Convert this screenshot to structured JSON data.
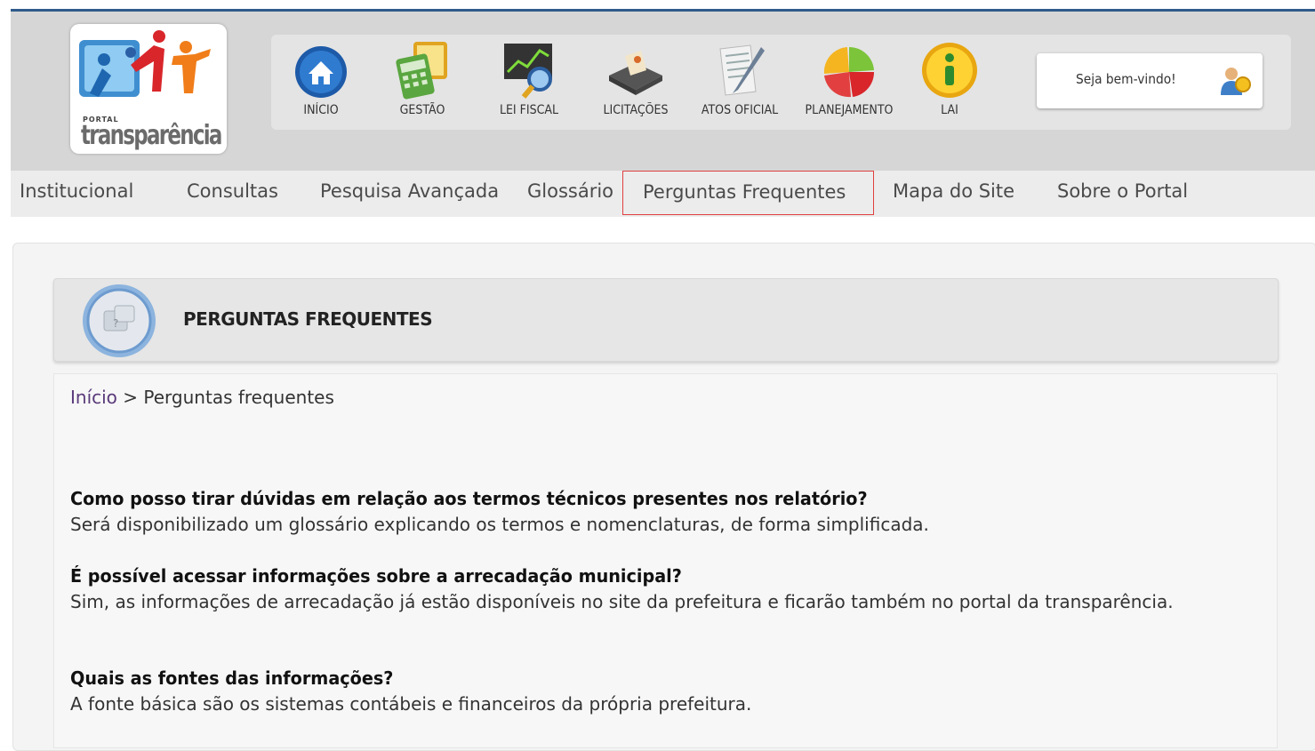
{
  "logo": {
    "portal": "PORTAL",
    "text": "transparência"
  },
  "toolbar": [
    {
      "label": "INÍCIO",
      "icon": "home-icon"
    },
    {
      "label": "GESTÃO",
      "icon": "calculator-icon"
    },
    {
      "label": "LEI FISCAL",
      "icon": "chart-magnifier-icon"
    },
    {
      "label": "LICITAÇÕES",
      "icon": "document-tray-icon"
    },
    {
      "label": "ATOS OFICIAL",
      "icon": "pen-paper-icon"
    },
    {
      "label": "PLANEJAMENTO",
      "icon": "pie-chart-icon"
    },
    {
      "label": "LAI",
      "icon": "info-icon"
    }
  ],
  "welcome": {
    "text": "Seja bem-vindo!",
    "icon": "user-icon"
  },
  "nav": [
    {
      "label": "Institucional"
    },
    {
      "label": "Consultas"
    },
    {
      "label": "Pesquisa Avançada"
    },
    {
      "label": "Glossário"
    },
    {
      "label": "Perguntas Frequentes",
      "active": true
    },
    {
      "label": "Mapa do Site"
    },
    {
      "label": "Sobre o Portal"
    }
  ],
  "page": {
    "title": "PERGUNTAS FREQUENTES",
    "icon": "faq-icon"
  },
  "breadcrumb": {
    "home": "Início",
    "separator": " > ",
    "current": "Perguntas frequentes"
  },
  "faq": [
    {
      "q": "Como posso tirar dúvidas em relação aos termos técnicos presentes nos relatório?",
      "a": "Será disponibilizado um glossário explicando os termos e nomenclaturas, de forma simplificada."
    },
    {
      "q": "É possível acessar informações sobre a arrecadação municipal?",
      "a": "Sim, as informações de arrecadação já estão disponíveis no site da prefeitura e ficarão também no portal da transparência."
    },
    {
      "q": "Quais as fontes das informações?",
      "a": "A fonte básica são os sistemas contábeis e financeiros da própria prefeitura."
    }
  ],
  "colors": {
    "header_bg": "#d6d6d6",
    "nav_bg": "#ececec",
    "active_border": "#e04040",
    "link": "#5a3a7a"
  }
}
